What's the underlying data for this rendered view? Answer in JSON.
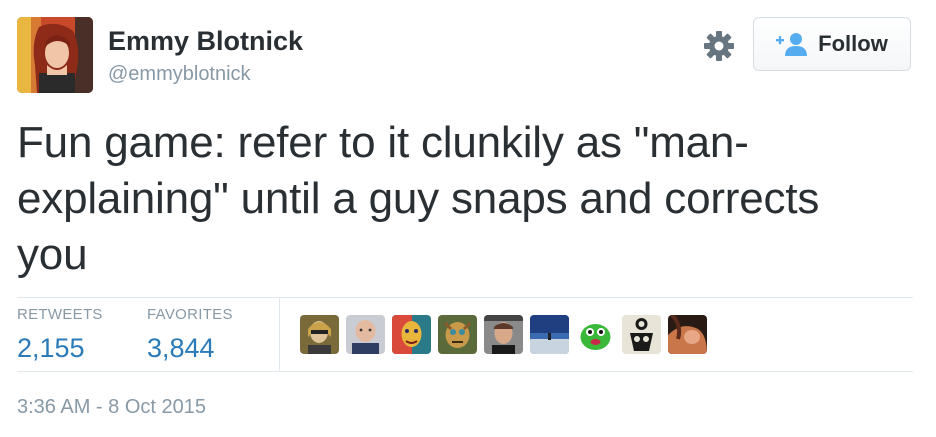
{
  "user": {
    "display_name": "Emmy Blotnick",
    "screen_name": "@emmyblotnick",
    "avatar_icon": "user-avatar"
  },
  "actions": {
    "settings_icon": "gear-icon",
    "follow_label": "Follow",
    "follow_icon": "add-user-icon"
  },
  "tweet": {
    "text_lines": [
      "Fun game: refer to it clunkily as \"man-",
      "explaining\" until a guy snaps and corrects",
      "you"
    ],
    "timestamp": "3:36 AM - 8 Oct 2015"
  },
  "stats": {
    "retweets_label": "RETWEETS",
    "retweets_value": "2,155",
    "favorites_label": "FAVORITES",
    "favorites_value": "3,844"
  },
  "favoriters": [
    {
      "icon": "favoriter-avatar-1"
    },
    {
      "icon": "favoriter-avatar-2"
    },
    {
      "icon": "favoriter-avatar-3"
    },
    {
      "icon": "favoriter-avatar-4"
    },
    {
      "icon": "favoriter-avatar-5"
    },
    {
      "icon": "favoriter-avatar-6"
    },
    {
      "icon": "favoriter-avatar-7"
    },
    {
      "icon": "favoriter-avatar-8"
    },
    {
      "icon": "favoriter-avatar-9"
    }
  ],
  "colors": {
    "text": "#292f33",
    "muted": "#8899a6",
    "link": "#2b7bb9",
    "follow_icon": "#55acee",
    "divider": "#e1e8ed"
  }
}
